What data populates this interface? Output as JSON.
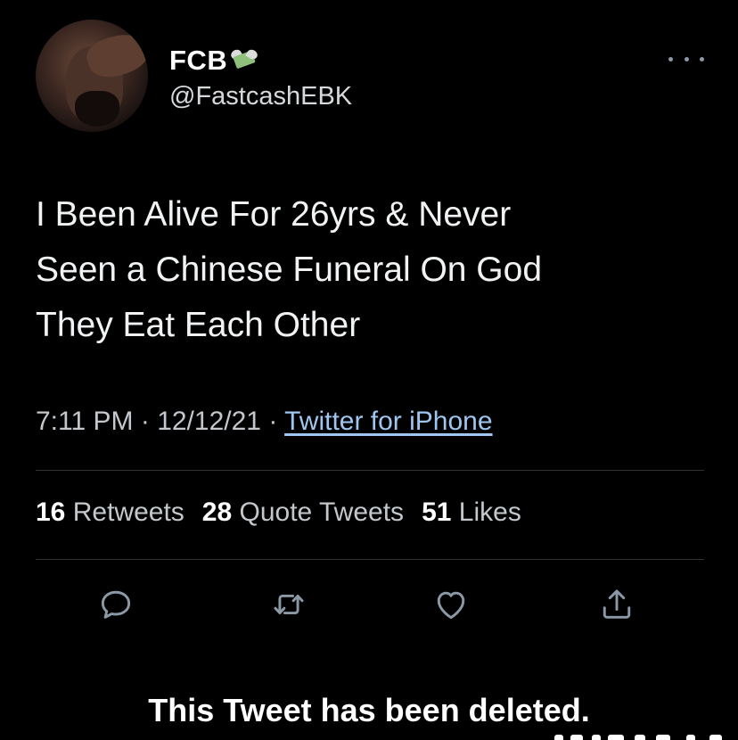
{
  "author": {
    "display_name": "FCB",
    "name_emoji": "money-with-wings-emoji",
    "handle": "@FastcashEBK"
  },
  "tweet": {
    "text_lines": [
      "I Been Alive For 26yrs & Never",
      "Seen a Chinese Funeral On God",
      "They Eat Each Other"
    ],
    "time": "7:11 PM",
    "separator": "·",
    "date": "12/12/21",
    "source": "Twitter for iPhone"
  },
  "stats": {
    "retweets_count": "16",
    "retweets_label": "Retweets",
    "quote_count": "28",
    "quote_label": "Quote Tweets",
    "likes_count": "51",
    "likes_label": "Likes"
  },
  "actions": {
    "icons": [
      "reply-icon",
      "retweet-icon",
      "like-icon",
      "share-icon"
    ]
  },
  "notice": {
    "deleted_text": "This Tweet has been deleted."
  },
  "colors": {
    "background": "#000000",
    "text_primary": "#ffffff",
    "text_secondary": "#c3c8cc",
    "link": "#9fc6f0",
    "icon": "#8b98a5",
    "divider": "#2f3336"
  }
}
